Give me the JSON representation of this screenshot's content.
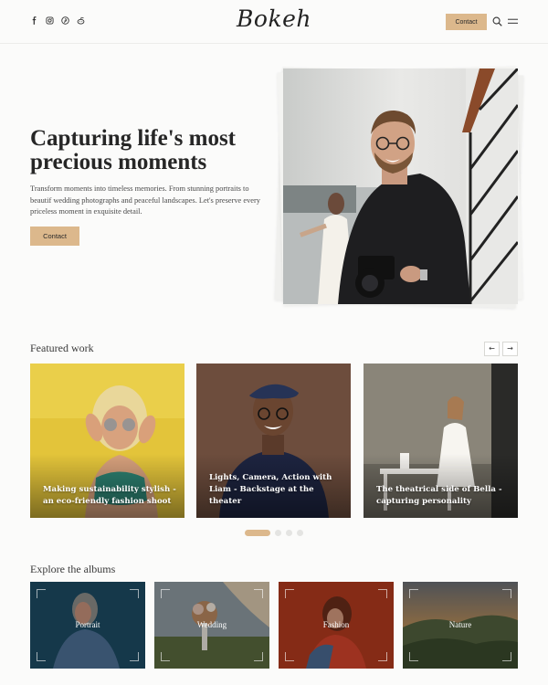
{
  "header": {
    "logo": "Bokeh",
    "contact_label": "Contact",
    "social_icons": [
      "facebook-icon",
      "instagram-icon",
      "pinterest-icon",
      "reddit-icon"
    ]
  },
  "hero": {
    "title_line1": "Capturing life's most",
    "title_line2": "precious moments",
    "subtitle": "Transform moments into timeless memories. From stunning portraits to beautif wedding photographs and peaceful landscapes. Let's preserve every priceless moment in exquisite detail.",
    "cta_label": "Contact"
  },
  "featured": {
    "title": "Featured work",
    "prev_label": "←",
    "next_label": "→",
    "cards": [
      {
        "caption": "Making sustainability stylish - an eco-friendly fashion shoot"
      },
      {
        "caption": "Lights, Camera, Action with Liam - Backstage at the theater"
      },
      {
        "caption": "The theatrical side of Bella - capturing personality"
      }
    ],
    "carousel": {
      "total": 4,
      "active": 1
    }
  },
  "albums": {
    "title": "Explore the albums",
    "items": [
      {
        "label": "Portrait"
      },
      {
        "label": "Wedding"
      },
      {
        "label": "Fashion"
      },
      {
        "label": "Nature"
      }
    ]
  },
  "colors": {
    "accent": "#dcb88c",
    "background": "#fbfbfa",
    "text": "#262626"
  }
}
